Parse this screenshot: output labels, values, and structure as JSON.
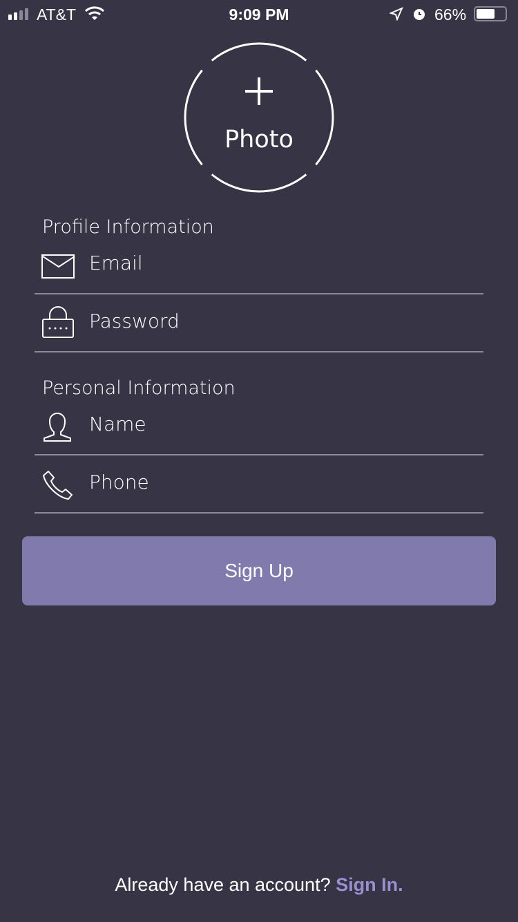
{
  "status": {
    "carrier": "AT&T",
    "time": "9:09 PM",
    "battery": "66%",
    "battery_level": 0.66
  },
  "photo": {
    "label": "Photo"
  },
  "profile": {
    "heading": "Profile Information",
    "email_placeholder": "Email",
    "password_placeholder": "Password"
  },
  "personal": {
    "heading": "Personal Information",
    "name_placeholder": "Name",
    "phone_placeholder": "Phone"
  },
  "signup_label": "Sign Up",
  "footer": {
    "prompt": "Already have an account?",
    "link": "Sign In."
  },
  "colors": {
    "background": "#373445",
    "button": "#807aad",
    "link": "#9a8fd0"
  }
}
